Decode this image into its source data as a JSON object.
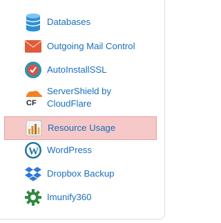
{
  "items": [
    {
      "label": "Databases",
      "icon": "database-icon"
    },
    {
      "label": "Outgoing Mail Control",
      "icon": "envelope-icon"
    },
    {
      "label": "AutoInstallSSL",
      "icon": "ssl-badge-icon"
    },
    {
      "label": "ServerShield by CloudFlare",
      "icon": "cloudflare-cf-icon"
    },
    {
      "label": "Resource Usage",
      "icon": "bar-chart-icon"
    },
    {
      "label": "WordPress",
      "icon": "wordpress-icon"
    },
    {
      "label": "Dropbox Backup",
      "icon": "dropbox-icon"
    },
    {
      "label": "Imunify360",
      "icon": "imunify-gear-icon"
    }
  ],
  "colors": {
    "link": "#1a6fba",
    "highlight": "#f6c8c8"
  }
}
